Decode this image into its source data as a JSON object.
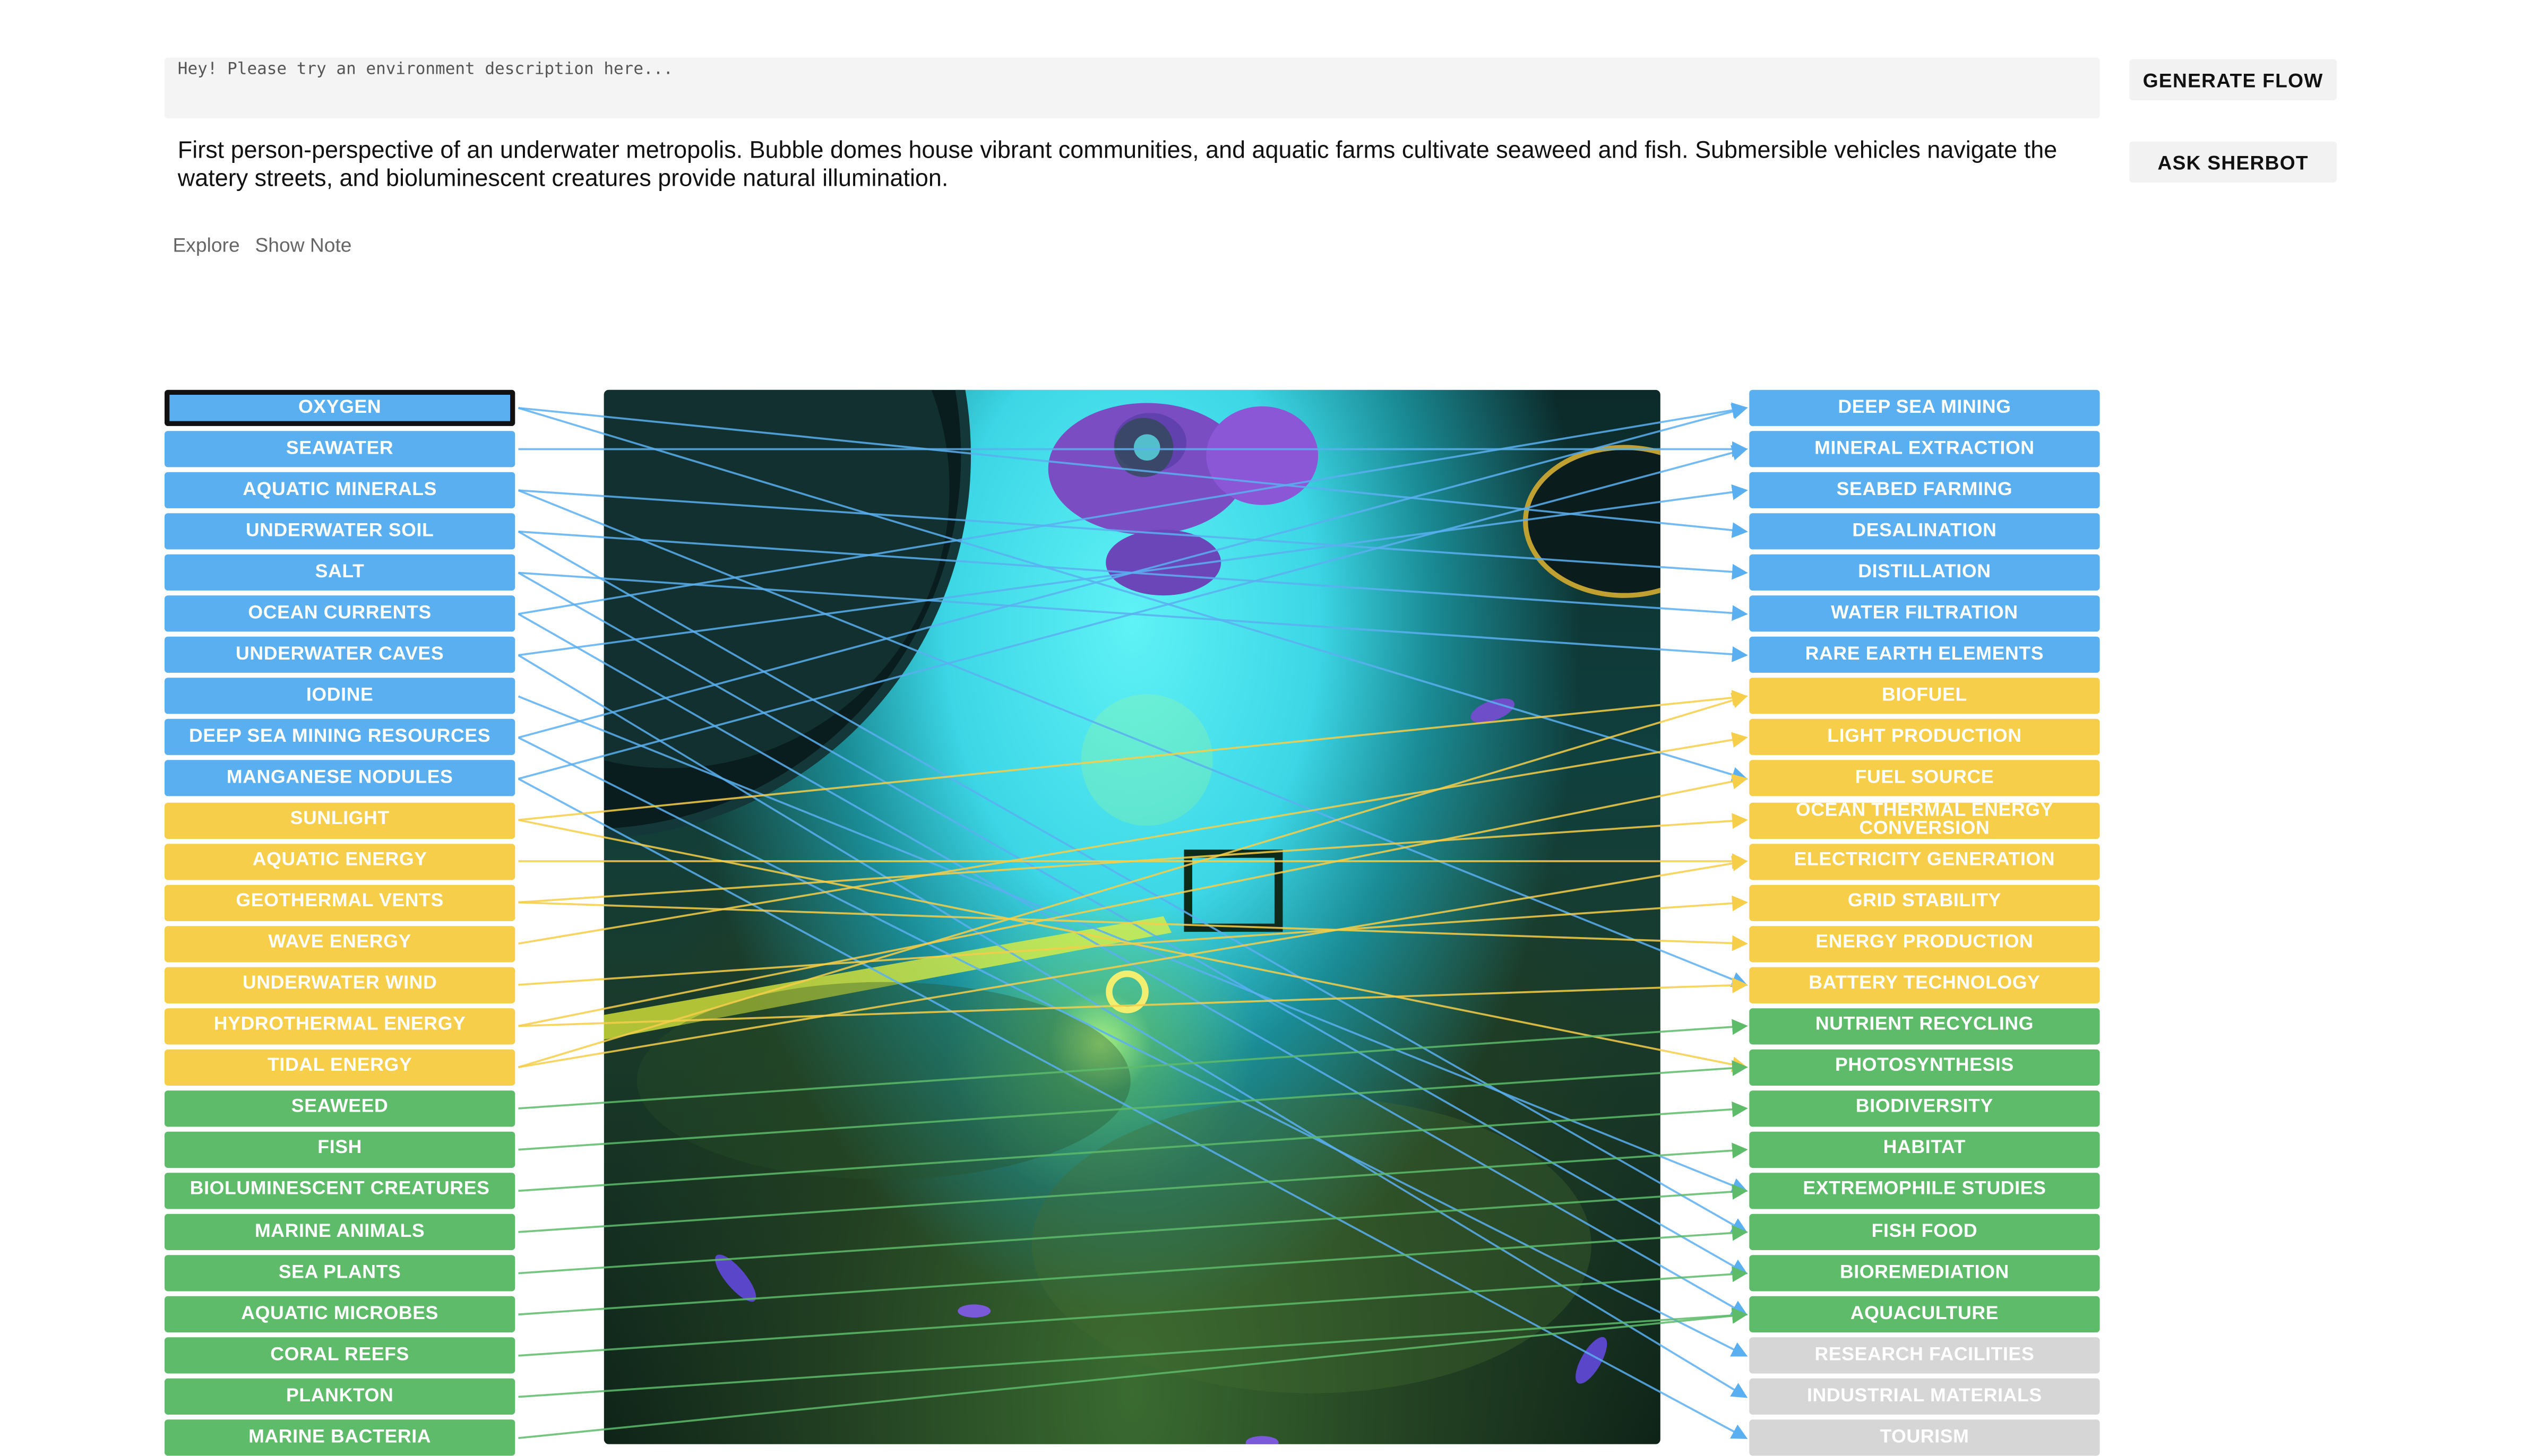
{
  "prompt": {
    "placeholder": "Hey! Please try an environment description here..."
  },
  "description": "First person-perspective of an underwater metropolis. Bubble domes house vibrant communities, and aquatic farms cultivate seaweed and fish. Submersible vehicles navigate the watery streets, and bioluminescent creatures provide natural illumination.",
  "links": {
    "explore": "Explore",
    "show_note": "Show Note"
  },
  "buttons": {
    "generate_flow": "GENERATE FLOW",
    "ask_sherbot": "ASK SHERBOT"
  },
  "colors": {
    "resource": "#5aaff0",
    "energy": "#f6ce4a",
    "ecology": "#5dbb6a",
    "inactive": "#d6d6d6",
    "selected_border": "#111111"
  },
  "left_tags": [
    {
      "label": "OXYGEN",
      "group": "resource",
      "selected": true
    },
    {
      "label": "SEAWATER",
      "group": "resource"
    },
    {
      "label": "AQUATIC MINERALS",
      "group": "resource"
    },
    {
      "label": "UNDERWATER SOIL",
      "group": "resource"
    },
    {
      "label": "SALT",
      "group": "resource"
    },
    {
      "label": "OCEAN CURRENTS",
      "group": "resource"
    },
    {
      "label": "UNDERWATER CAVES",
      "group": "resource"
    },
    {
      "label": "IODINE",
      "group": "resource"
    },
    {
      "label": "DEEP SEA MINING RESOURCES",
      "group": "resource"
    },
    {
      "label": "MANGANESE NODULES",
      "group": "resource"
    },
    {
      "label": "SUNLIGHT",
      "group": "energy"
    },
    {
      "label": "AQUATIC ENERGY",
      "group": "energy"
    },
    {
      "label": "GEOTHERMAL VENTS",
      "group": "energy"
    },
    {
      "label": "WAVE ENERGY",
      "group": "energy"
    },
    {
      "label": "UNDERWATER WIND",
      "group": "energy"
    },
    {
      "label": "HYDROTHERMAL ENERGY",
      "group": "energy"
    },
    {
      "label": "TIDAL ENERGY",
      "group": "energy"
    },
    {
      "label": "SEAWEED",
      "group": "ecology"
    },
    {
      "label": "FISH",
      "group": "ecology"
    },
    {
      "label": "BIOLUMINESCENT CREATURES",
      "group": "ecology"
    },
    {
      "label": "MARINE ANIMALS",
      "group": "ecology"
    },
    {
      "label": "SEA PLANTS",
      "group": "ecology"
    },
    {
      "label": "AQUATIC MICROBES",
      "group": "ecology"
    },
    {
      "label": "CORAL REEFS",
      "group": "ecology"
    },
    {
      "label": "PLANKTON",
      "group": "ecology"
    },
    {
      "label": "MARINE BACTERIA",
      "group": "ecology"
    }
  ],
  "right_tags": [
    {
      "label": "DEEP SEA MINING",
      "group": "resource"
    },
    {
      "label": "MINERAL EXTRACTION",
      "group": "resource"
    },
    {
      "label": "SEABED FARMING",
      "group": "resource"
    },
    {
      "label": "DESALINATION",
      "group": "resource"
    },
    {
      "label": "DISTILLATION",
      "group": "resource"
    },
    {
      "label": "WATER FILTRATION",
      "group": "resource"
    },
    {
      "label": "RARE EARTH ELEMENTS",
      "group": "resource"
    },
    {
      "label": "BIOFUEL",
      "group": "energy"
    },
    {
      "label": "LIGHT PRODUCTION",
      "group": "energy"
    },
    {
      "label": "FUEL SOURCE",
      "group": "energy"
    },
    {
      "label": "OCEAN THERMAL ENERGY CONVERSION",
      "group": "energy"
    },
    {
      "label": "ELECTRICITY GENERATION",
      "group": "energy"
    },
    {
      "label": "GRID STABILITY",
      "group": "energy"
    },
    {
      "label": "ENERGY PRODUCTION",
      "group": "energy"
    },
    {
      "label": "BATTERY TECHNOLOGY",
      "group": "energy"
    },
    {
      "label": "NUTRIENT RECYCLING",
      "group": "ecology"
    },
    {
      "label": "PHOTOSYNTHESIS",
      "group": "ecology"
    },
    {
      "label": "BIODIVERSITY",
      "group": "ecology"
    },
    {
      "label": "HABITAT",
      "group": "ecology"
    },
    {
      "label": "EXTREMOPHILE STUDIES",
      "group": "ecology"
    },
    {
      "label": "FISH FOOD",
      "group": "ecology"
    },
    {
      "label": "BIOREMEDIATION",
      "group": "ecology"
    },
    {
      "label": "AQUACULTURE",
      "group": "ecology"
    },
    {
      "label": "RESEARCH FACILITIES",
      "group": "inactive"
    },
    {
      "label": "INDUSTRIAL MATERIALS",
      "group": "inactive"
    },
    {
      "label": "TOURISM",
      "group": "inactive"
    }
  ],
  "connections": [
    [
      0,
      3,
      "resource"
    ],
    [
      0,
      9,
      "resource"
    ],
    [
      1,
      1,
      "resource"
    ],
    [
      2,
      4,
      "resource"
    ],
    [
      2,
      14,
      "resource"
    ],
    [
      3,
      5,
      "resource"
    ],
    [
      3,
      20,
      "resource"
    ],
    [
      4,
      6,
      "resource"
    ],
    [
      4,
      21,
      "resource"
    ],
    [
      5,
      0,
      "resource"
    ],
    [
      5,
      22,
      "resource"
    ],
    [
      6,
      2,
      "resource"
    ],
    [
      6,
      24,
      "resource"
    ],
    [
      7,
      19,
      "resource"
    ],
    [
      8,
      0,
      "resource"
    ],
    [
      8,
      23,
      "resource"
    ],
    [
      9,
      1,
      "resource"
    ],
    [
      9,
      25,
      "resource"
    ],
    [
      10,
      7,
      "energy"
    ],
    [
      10,
      16,
      "energy"
    ],
    [
      11,
      11,
      "energy"
    ],
    [
      12,
      10,
      "energy"
    ],
    [
      12,
      13,
      "energy"
    ],
    [
      13,
      8,
      "energy"
    ],
    [
      14,
      12,
      "energy"
    ],
    [
      15,
      9,
      "energy"
    ],
    [
      15,
      14,
      "energy"
    ],
    [
      16,
      7,
      "energy"
    ],
    [
      16,
      11,
      "energy"
    ],
    [
      17,
      15,
      "ecology"
    ],
    [
      18,
      16,
      "ecology"
    ],
    [
      19,
      17,
      "ecology"
    ],
    [
      20,
      18,
      "ecology"
    ],
    [
      21,
      19,
      "ecology"
    ],
    [
      22,
      20,
      "ecology"
    ],
    [
      23,
      21,
      "ecology"
    ],
    [
      24,
      22,
      "ecology"
    ],
    [
      25,
      22,
      "ecology"
    ]
  ]
}
